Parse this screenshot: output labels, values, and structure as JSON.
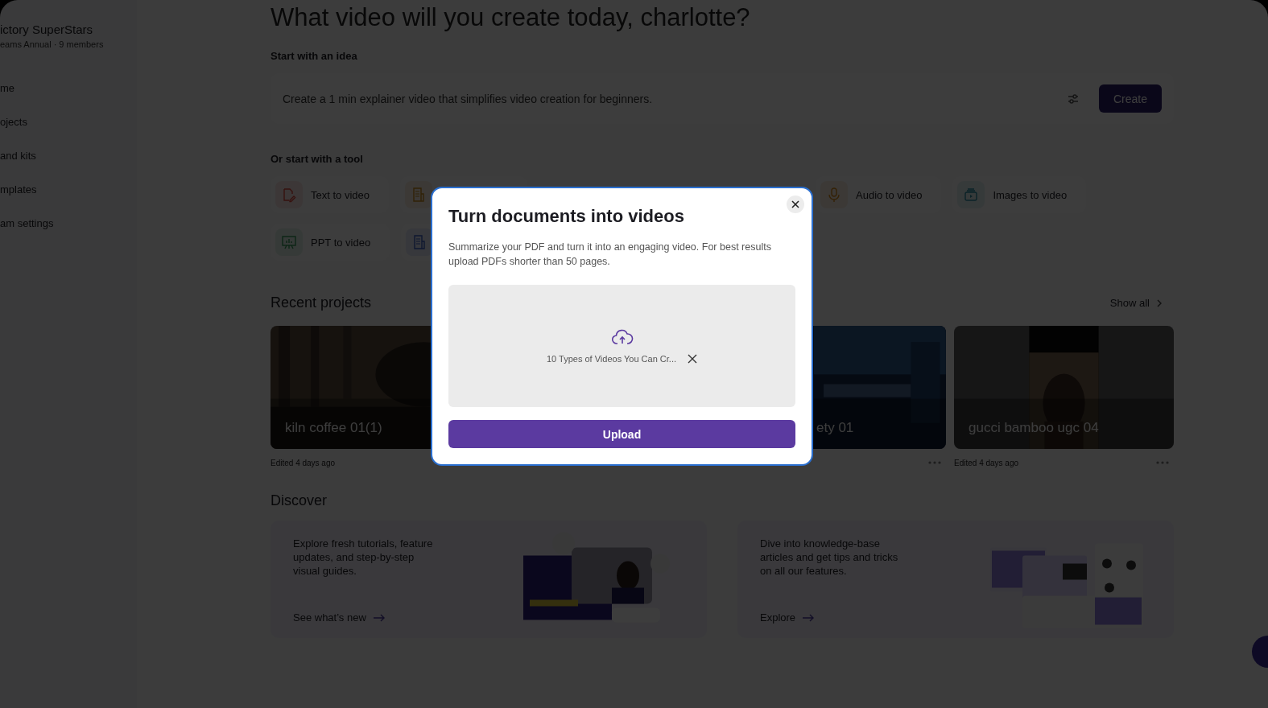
{
  "sidebar": {
    "workspace_name": "ictory SuperStars",
    "plan": "eams Annual · 9 members",
    "items": [
      {
        "label": "me"
      },
      {
        "label": "ojects"
      },
      {
        "label": "and kits"
      },
      {
        "label": "mplates"
      },
      {
        "label": "am settings"
      }
    ]
  },
  "heading": "What video will you create today, charlotte?",
  "idea": {
    "title": "Start with an idea",
    "value": "Create a 1 min explainer video that simplifies video creation for beginners.",
    "button": "Create"
  },
  "tools": {
    "title": "Or start with a tool",
    "items": [
      {
        "kind": "text",
        "label": "Text to video"
      },
      {
        "kind": "document"
      },
      {
        "kind": "hidden"
      },
      {
        "kind": "hidden"
      },
      {
        "kind": "audio",
        "label": "Audio to video"
      },
      {
        "kind": "images",
        "label": "Images to video"
      },
      {
        "kind": "ppt",
        "label": "PPT to video"
      },
      {
        "kind": "pdf"
      }
    ]
  },
  "recent": {
    "title": "Recent projects",
    "show_all": "Show all",
    "projects": [
      {
        "kind": "full",
        "title": "kiln coffee 01(1)",
        "caption": "Edited 4 days ago",
        "menu": false
      },
      {
        "kind": "hidden"
      },
      {
        "kind": "partial",
        "title": "ety 01",
        "menu": true
      },
      {
        "kind": "portrait",
        "title": "gucci bamboo ugc 04",
        "caption": "Edited 4 days ago",
        "menu": true
      }
    ]
  },
  "discover": {
    "title": "Discover",
    "cards": [
      {
        "text": "Explore fresh tutorials, feature updates, and step-by-step visual guides.",
        "link": "See what’s new"
      },
      {
        "text": "Dive into knowledge-base articles and get tips and tricks on all our features.",
        "link": "Explore"
      }
    ]
  },
  "modal": {
    "title": "Turn documents into videos",
    "description": "Summarize your PDF and turn it into an engaging video. For best results upload PDFs shorter than 50 pages.",
    "file_name": "10 Types of Videos You Can Cr...",
    "button": "Upload"
  }
}
